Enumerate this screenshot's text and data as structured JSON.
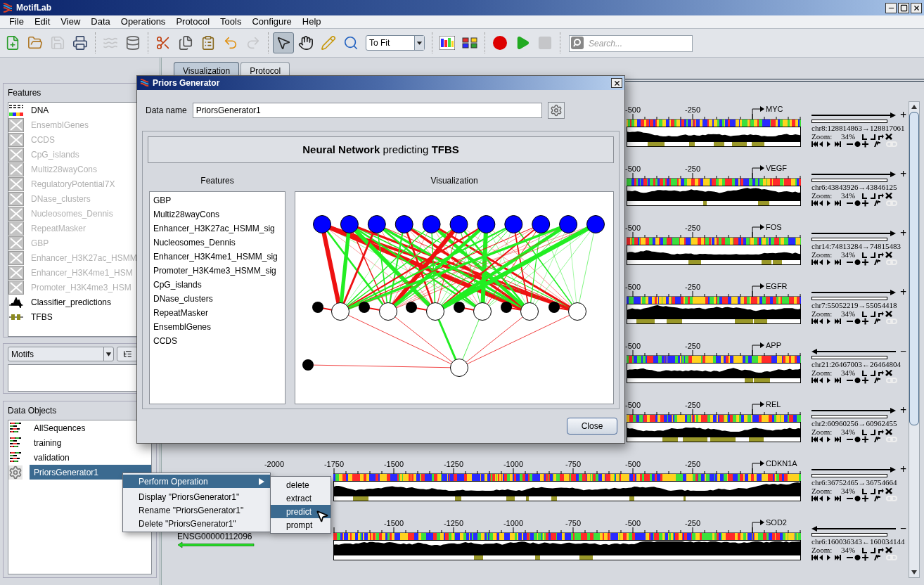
{
  "window": {
    "title": "MotifLab"
  },
  "menu": [
    "File",
    "Edit",
    "View",
    "Data",
    "Operations",
    "Protocol",
    "Tools",
    "Configure",
    "Help"
  ],
  "toolbar": {
    "groups": [
      [
        {
          "kind": "new",
          "disabled": false
        },
        {
          "kind": "open",
          "disabled": false
        },
        {
          "kind": "save",
          "disabled": true
        },
        {
          "kind": "print",
          "disabled": false
        }
      ],
      [
        {
          "kind": "sequences",
          "disabled": true
        },
        {
          "kind": "database",
          "disabled": false
        }
      ],
      [
        {
          "kind": "cut",
          "disabled": false
        },
        {
          "kind": "copy",
          "disabled": false
        },
        {
          "kind": "paste",
          "disabled": false
        },
        {
          "kind": "undo",
          "disabled": false
        },
        {
          "kind": "redo",
          "disabled": true
        }
      ],
      [
        {
          "kind": "select",
          "selected": true
        },
        {
          "kind": "pan",
          "selected": false
        },
        {
          "kind": "draw",
          "selected": false
        },
        {
          "kind": "zoom",
          "selected": false
        },
        {
          "kind": "dropdown",
          "value": "To Fit"
        }
      ],
      [
        {
          "kind": "motif"
        },
        {
          "kind": "compare"
        }
      ],
      [
        {
          "kind": "record",
          "disabled": false
        },
        {
          "kind": "play",
          "disabled": false
        },
        {
          "kind": "stop",
          "disabled": true
        }
      ],
      [
        {
          "kind": "search",
          "placeholder": "Search..."
        }
      ]
    ]
  },
  "tabs": [
    {
      "label": "Visualization",
      "selected": true
    },
    {
      "label": "Protocol",
      "selected": false
    }
  ],
  "features_panel": {
    "title": "Features",
    "items": [
      {
        "name": "DNA",
        "kind": "sequence",
        "visible": true
      },
      {
        "name": "EnsemblGenes",
        "visible": false
      },
      {
        "name": "CCDS",
        "visible": false
      },
      {
        "name": "CpG_islands",
        "visible": false
      },
      {
        "name": "Multiz28wayCons",
        "visible": false
      },
      {
        "name": "RegulatoryPotential7X",
        "visible": false
      },
      {
        "name": "DNase_clusters",
        "visible": false
      },
      {
        "name": "Nucleosomes_Dennis",
        "visible": false
      },
      {
        "name": "RepeatMasker",
        "visible": false
      },
      {
        "name": "GBP",
        "visible": false
      },
      {
        "name": "Enhancer_H3K27ac_HSMM",
        "visible": false
      },
      {
        "name": "Enhancer_H3K4me1_HSM",
        "visible": false
      },
      {
        "name": "Promoter_H3K4me3_HSM",
        "visible": false
      },
      {
        "name": "Classifier_predictions",
        "kind": "numeric",
        "visible": true
      },
      {
        "name": "TFBS",
        "kind": "region",
        "visible": true
      }
    ]
  },
  "motifs_panel": {
    "selector": "Motifs"
  },
  "data_objects_panel": {
    "title": "Data Objects",
    "items": [
      {
        "name": "AllSequences",
        "kind": "collection",
        "selected": false
      },
      {
        "name": "training",
        "kind": "collection",
        "selected": false
      },
      {
        "name": "validation",
        "kind": "collection",
        "selected": false
      },
      {
        "name": "PriorsGenerator1",
        "kind": "generator",
        "selected": true
      }
    ]
  },
  "tracks": [
    {
      "ticks": [
        "-500",
        "-250"
      ],
      "gene": "MYC",
      "kind": "forward",
      "strand": "+",
      "coordinates": "chr8:128814863→128817061",
      "zoom_label": "Zoom:",
      "zoom": "34%"
    },
    {
      "ticks": [
        "-500",
        "-250"
      ],
      "gene": "VEGF",
      "kind": "forward",
      "strand": "+",
      "coordinates": "chr6:43843926→43846125",
      "zoom_label": "Zoom:",
      "zoom": "34%"
    },
    {
      "ticks": [
        "-500",
        "-250"
      ],
      "gene": "FOS",
      "kind": "forward",
      "strand": "+",
      "coordinates": "chr14:74813284→74815483",
      "zoom_label": "Zoom:",
      "zoom": "34%"
    },
    {
      "ticks": [
        "-500",
        "-250"
      ],
      "gene": "EGFR",
      "kind": "forward",
      "strand": "+",
      "coordinates": "chr7:55052219→55054418",
      "zoom_label": "Zoom:",
      "zoom": "34%"
    },
    {
      "ticks": [
        "-500",
        "-250"
      ],
      "gene": "APP",
      "kind": "reverse",
      "strand": "−",
      "coordinates": "chr21:26467003←26464804",
      "zoom_label": "Zoom:",
      "zoom": "34%"
    },
    {
      "ticks": [
        "-500",
        "-250"
      ],
      "gene": "REL",
      "kind": "forward",
      "strand": "+",
      "coordinates": "chr2:60960256→60962455",
      "zoom_label": "Zoom:",
      "zoom": "34%"
    },
    {
      "ticks": [
        "-2000",
        "-1750",
        "-1500",
        "-1250",
        "-1000",
        "-750",
        "-500",
        "-250"
      ],
      "gene": "CDKN1A",
      "kind": "forward",
      "strand": "+",
      "coordinates": "chr6:36752465→36754664",
      "zoom_label": "Zoom:",
      "zoom": "34%"
    },
    {
      "ticks": [
        "-1500",
        "-1250",
        "-1000",
        "-750",
        "-500",
        "-250"
      ],
      "gene": "SOD2",
      "kind": "reverse",
      "strand": "−",
      "coordinates": "chr6:160036343←160034144",
      "zoom_label": "Zoom:",
      "zoom": "34%",
      "label": "ENSG00000112096"
    }
  ],
  "dialog": {
    "title": "Priors Generator",
    "data_name_label": "Data name",
    "data_name": "PriorsGenerator1",
    "description": "**Neural Network** predicting **TFBS**",
    "features_heading": "Features",
    "features": [
      "GBP",
      "Multiz28wayCons",
      "Enhancer_H3K27ac_HSMM_sig",
      "Nucleosomes_Dennis",
      "Enhancer_H3K4me1_HSMM_sig",
      "Promoter_H3K4me3_HSMM_sig",
      "CpG_islands",
      "DNase_clusters",
      "RepeatMasker",
      "EnsemblGenes",
      "CCDS"
    ],
    "visualization_heading": "Visualization",
    "close_button": "Close"
  },
  "context_menu": {
    "items": [
      {
        "label": "Perform Operation",
        "selected": true,
        "submenu": true
      },
      {
        "label": "Display \"PriorsGenerator1\"",
        "selected": false,
        "submenu": false
      },
      {
        "label": "Rename \"PriorsGenerator1\"",
        "selected": false,
        "submenu": false
      },
      {
        "label": "Delete \"PriorsGenerator1\"",
        "selected": false,
        "submenu": false
      }
    ],
    "submenu": [
      {
        "label": "delete",
        "selected": false
      },
      {
        "label": "extract",
        "selected": false
      },
      {
        "label": "predict",
        "selected": true
      },
      {
        "label": "prompt",
        "selected": false
      }
    ]
  }
}
